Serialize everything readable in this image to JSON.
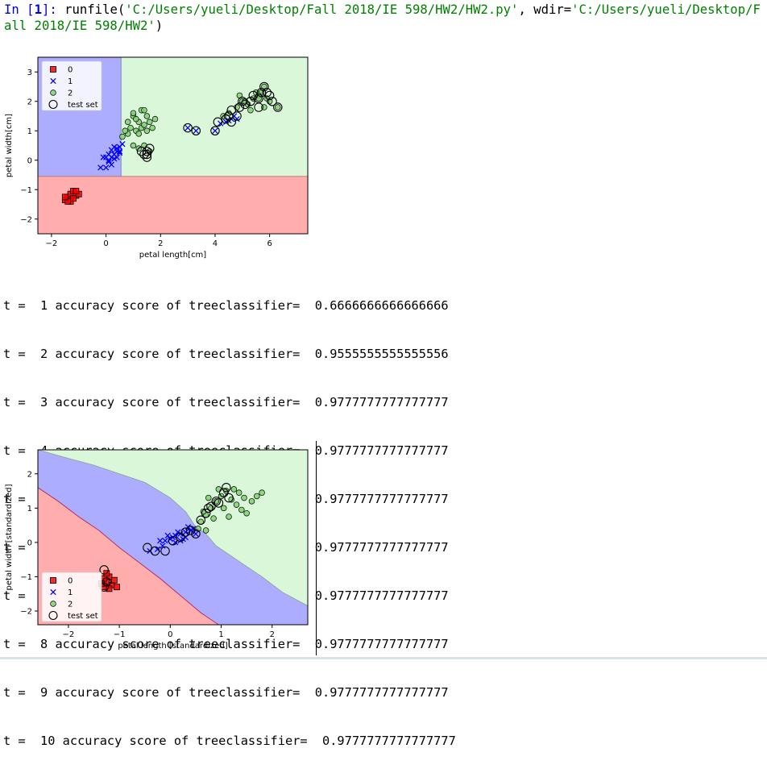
{
  "console": {
    "prompt_in": "In [",
    "prompt_num": "1",
    "prompt_close": "]: ",
    "call": "runfile(",
    "path": "'C:/Users/yueli/Desktop/Fall 2018/IE 598/HW2/HW2.py'",
    "sep": ", wdir=",
    "wdir": "'C:/Users/yueli/Desktop/Fall 2018/IE 598/HW2'",
    "close": ")"
  },
  "output_lines": [
    "t =  1 accuracy score of treeclassifier=  0.6666666666666666",
    "t =  2 accuracy score of treeclassifier=  0.9555555555555556",
    "t =  3 accuracy score of treeclassifier=  0.9777777777777777",
    "t =  4 accuracy score of treeclassifier=  0.9777777777777777",
    "t =  5 accuracy score of treeclassifier=  0.9777777777777777",
    "t =  6 accuracy score of treeclassifier=  0.9777777777777777",
    "t =  7 accuracy score of treeclassifier=  0.9777777777777777",
    "t =  8 accuracy score of treeclassifier=  0.9777777777777777",
    "t =  9 accuracy score of treeclassifier=  0.9777777777777777",
    "t =  10 accuracy score of treeclassifier=  0.9777777777777777"
  ],
  "colors": {
    "class0": "#ff0000",
    "class1": "#0000ff",
    "class2": "#7cd26f",
    "region0": "#ffadad",
    "region1": "#adadff",
    "region2": "#daf7da",
    "prompt": "#0000e0",
    "string": "#008000"
  },
  "chart_data": [
    {
      "type": "scatter",
      "title": "",
      "xlabel": "petal length[cm]",
      "ylabel": "petal width[cm]",
      "xlim": [
        -2.5,
        7.4
      ],
      "ylim": [
        -2.5,
        3.5
      ],
      "xticks": [
        -2,
        0,
        2,
        4,
        6
      ],
      "yticks": [
        -2,
        -1,
        0,
        1,
        2,
        3
      ],
      "xtick_labels": [
        "−2",
        "0",
        "2",
        "4",
        "6"
      ],
      "ytick_labels": [
        "−2",
        "−1",
        "0",
        "1",
        "2",
        "3"
      ],
      "legend_position": "top-left",
      "legend": [
        "0",
        "1",
        "2",
        "test set"
      ],
      "regions": [
        {
          "class": "0",
          "x": [
            -2.5,
            7.4
          ],
          "y": [
            -2.5,
            -0.55
          ]
        },
        {
          "class": "1",
          "x": [
            -2.5,
            0.55
          ],
          "y": [
            -0.55,
            3.5
          ]
        },
        {
          "class": "2",
          "x": [
            0.55,
            7.4
          ],
          "y": [
            -0.55,
            3.5
          ]
        }
      ],
      "series": [
        {
          "name": "0",
          "marker": "square",
          "points": [
            [
              -1.5,
              -1.35
            ],
            [
              -1.4,
              -1.25
            ],
            [
              -1.3,
              -1.3
            ],
            [
              -1.3,
              -1.15
            ],
            [
              -1.2,
              -1.05
            ],
            [
              -1.1,
              -1.2
            ],
            [
              -1.3,
              -1.4
            ],
            [
              -1.4,
              -1.4
            ],
            [
              -1.2,
              -1.3
            ],
            [
              -1.0,
              -1.15
            ],
            [
              -1.5,
              -1.25
            ],
            [
              -1.1,
              -1.05
            ]
          ]
        },
        {
          "name": "1",
          "marker": "x",
          "points": [
            [
              -0.2,
              -0.25
            ],
            [
              0.0,
              -0.25
            ],
            [
              0.1,
              0.0
            ],
            [
              0.2,
              0.1
            ],
            [
              0.3,
              0.2
            ],
            [
              0.4,
              0.3
            ],
            [
              0.5,
              0.45
            ],
            [
              0.2,
              0.35
            ],
            [
              0.1,
              0.2
            ],
            [
              0.3,
              0.05
            ],
            [
              0.5,
              0.25
            ],
            [
              0.0,
              0.1
            ],
            [
              -0.1,
              0.1
            ],
            [
              0.4,
              0.1
            ],
            [
              0.6,
              0.55
            ],
            [
              0.2,
              -0.15
            ],
            [
              0.3,
              0.45
            ],
            [
              0.1,
              -0.05
            ],
            [
              0.4,
              0.4
            ],
            [
              0.5,
              0.3
            ],
            [
              3.0,
              1.1
            ],
            [
              3.3,
              1.0
            ],
            [
              4.0,
              1.0
            ],
            [
              4.2,
              1.25
            ],
            [
              4.4,
              1.3
            ],
            [
              4.6,
              1.4
            ],
            [
              4.7,
              1.5
            ],
            [
              4.8,
              1.4
            ],
            [
              4.5,
              1.35
            ]
          ]
        },
        {
          "name": "2",
          "marker": "circle",
          "points": [
            [
              0.6,
              0.8
            ],
            [
              0.8,
              0.9
            ],
            [
              0.9,
              1.1
            ],
            [
              0.8,
              1.3
            ],
            [
              1.0,
              1.5
            ],
            [
              1.2,
              1.3
            ],
            [
              1.3,
              1.1
            ],
            [
              1.1,
              1.0
            ],
            [
              1.4,
              1.2
            ],
            [
              1.5,
              1.5
            ],
            [
              1.3,
              1.7
            ],
            [
              1.6,
              1.3
            ],
            [
              1.7,
              1.1
            ],
            [
              1.8,
              1.4
            ],
            [
              1.0,
              1.6
            ],
            [
              1.2,
              0.9
            ],
            [
              1.4,
              1.7
            ],
            [
              0.7,
              1.0
            ],
            [
              1.1,
              1.4
            ],
            [
              1.5,
              1.0
            ],
            [
              1.2,
              0.4
            ],
            [
              1.4,
              0.5
            ],
            [
              1.6,
              0.3
            ],
            [
              1.0,
              0.5
            ],
            [
              4.3,
              1.5
            ],
            [
              4.5,
              1.6
            ],
            [
              4.8,
              1.8
            ],
            [
              5.0,
              2.0
            ],
            [
              5.2,
              1.9
            ],
            [
              5.4,
              2.1
            ],
            [
              5.5,
              2.3
            ],
            [
              5.7,
              2.3
            ],
            [
              5.9,
              2.1
            ],
            [
              6.0,
              2.0
            ],
            [
              5.8,
              1.8
            ],
            [
              5.6,
              2.2
            ],
            [
              5.1,
              2.0
            ],
            [
              6.3,
              1.8
            ],
            [
              5.3,
              1.7
            ],
            [
              4.9,
              2.2
            ],
            [
              5.8,
              2.5
            ],
            [
              5.6,
              2.1
            ]
          ]
        },
        {
          "name": "test set",
          "marker": "ring",
          "points": [
            [
              1.3,
              0.3
            ],
            [
              1.4,
              0.2
            ],
            [
              1.5,
              0.3
            ],
            [
              1.5,
              0.1
            ],
            [
              1.6,
              0.4
            ],
            [
              1.5,
              0.2
            ],
            [
              3.0,
              1.1
            ],
            [
              3.3,
              1.0
            ],
            [
              4.0,
              1.0
            ],
            [
              4.1,
              1.3
            ],
            [
              4.4,
              1.4
            ],
            [
              4.6,
              1.3
            ],
            [
              4.5,
              1.5
            ],
            [
              4.8,
              1.5
            ],
            [
              4.6,
              1.7
            ],
            [
              4.9,
              1.8
            ],
            [
              5.0,
              2.0
            ],
            [
              5.1,
              1.9
            ],
            [
              5.3,
              2.0
            ],
            [
              5.4,
              2.2
            ],
            [
              5.6,
              2.1
            ],
            [
              5.7,
              2.3
            ],
            [
              5.8,
              2.5
            ],
            [
              5.9,
              2.3
            ],
            [
              6.0,
              2.2
            ],
            [
              6.1,
              2.0
            ],
            [
              5.6,
              1.8
            ],
            [
              6.3,
              1.8
            ]
          ]
        }
      ]
    },
    {
      "type": "scatter",
      "title": "",
      "xlabel": "petal length [standardized]",
      "ylabel": "petal width [standardized]",
      "xlim": [
        -2.6,
        2.7
      ],
      "ylim": [
        -2.4,
        2.7
      ],
      "xticks": [
        -2,
        -1,
        0,
        1,
        2
      ],
      "yticks": [
        -2,
        -1,
        0,
        1,
        2
      ],
      "xtick_labels": [
        "−2",
        "−1",
        "0",
        "1",
        "2"
      ],
      "ytick_labels": [
        "−2",
        "−1",
        "0",
        "1",
        "2"
      ],
      "legend_position": "lower-left",
      "legend": [
        "0",
        "1",
        "2",
        "test set"
      ],
      "boundaries": {
        "upper": [
          [
            -2.6,
            2.7
          ],
          [
            -2.0,
            2.45
          ],
          [
            -1.5,
            2.25
          ],
          [
            -1.0,
            2.0
          ],
          [
            -0.5,
            1.75
          ],
          [
            0.0,
            1.3
          ],
          [
            0.3,
            0.9
          ],
          [
            0.5,
            0.45
          ],
          [
            0.7,
            0.25
          ],
          [
            0.9,
            -0.1
          ],
          [
            1.3,
            -0.5
          ],
          [
            1.8,
            -1.0
          ],
          [
            2.2,
            -1.45
          ],
          [
            2.7,
            -1.85
          ]
        ],
        "lower": [
          [
            -2.6,
            1.6
          ],
          [
            -2.2,
            1.2
          ],
          [
            -1.8,
            0.75
          ],
          [
            -1.4,
            0.35
          ],
          [
            -1.0,
            -0.15
          ],
          [
            -0.6,
            -0.6
          ],
          [
            -0.2,
            -1.05
          ],
          [
            0.2,
            -1.55
          ],
          [
            0.6,
            -2.05
          ],
          [
            0.95,
            -2.4
          ]
        ]
      },
      "series": [
        {
          "name": "0",
          "marker": "square",
          "points": [
            [
              -1.3,
              -1.3
            ],
            [
              -1.25,
              -1.15
            ],
            [
              -1.2,
              -1.0
            ],
            [
              -1.15,
              -1.25
            ],
            [
              -1.1,
              -1.1
            ],
            [
              -1.3,
              -1.05
            ],
            [
              -1.05,
              -1.3
            ],
            [
              -1.2,
              -1.35
            ],
            [
              -1.35,
              -1.2
            ],
            [
              -1.25,
              -0.9
            ]
          ]
        },
        {
          "name": "1",
          "marker": "x",
          "points": [
            [
              -0.4,
              -0.25
            ],
            [
              -0.25,
              -0.2
            ],
            [
              -0.15,
              -0.1
            ],
            [
              -0.1,
              0.05
            ],
            [
              0.0,
              0.1
            ],
            [
              0.1,
              0.2
            ],
            [
              0.2,
              0.25
            ],
            [
              0.3,
              0.3
            ],
            [
              0.4,
              0.35
            ],
            [
              0.45,
              0.4
            ],
            [
              0.3,
              0.15
            ],
            [
              0.2,
              0.05
            ],
            [
              0.1,
              0.0
            ],
            [
              0.5,
              0.25
            ],
            [
              0.35,
              0.45
            ],
            [
              0.15,
              0.3
            ],
            [
              -0.05,
              0.2
            ],
            [
              0.25,
              0.1
            ],
            [
              0.05,
              0.15
            ],
            [
              -0.2,
              0.05
            ]
          ]
        },
        {
          "name": "2",
          "marker": "circle",
          "points": [
            [
              0.6,
              0.6
            ],
            [
              0.7,
              0.8
            ],
            [
              0.8,
              1.0
            ],
            [
              0.9,
              1.2
            ],
            [
              1.0,
              1.35
            ],
            [
              1.1,
              1.5
            ],
            [
              1.2,
              1.25
            ],
            [
              1.3,
              1.1
            ],
            [
              1.4,
              0.95
            ],
            [
              1.5,
              0.85
            ],
            [
              1.6,
              1.2
            ],
            [
              1.7,
              1.35
            ],
            [
              1.8,
              1.45
            ],
            [
              0.75,
              1.3
            ],
            [
              0.95,
              1.55
            ],
            [
              1.05,
              1.0
            ],
            [
              0.65,
              0.9
            ],
            [
              1.25,
              1.55
            ],
            [
              1.15,
              0.75
            ],
            [
              1.35,
              1.45
            ],
            [
              0.85,
              0.7
            ],
            [
              1.45,
              1.3
            ],
            [
              0.55,
              0.4
            ],
            [
              0.7,
              0.35
            ]
          ]
        },
        {
          "name": "test set",
          "marker": "ring",
          "points": [
            [
              -0.45,
              -0.15
            ],
            [
              -0.3,
              -0.25
            ],
            [
              -0.1,
              -0.25
            ],
            [
              0.05,
              0.05
            ],
            [
              0.2,
              0.15
            ],
            [
              0.3,
              0.3
            ],
            [
              0.4,
              0.35
            ],
            [
              0.5,
              0.25
            ],
            [
              0.6,
              0.65
            ],
            [
              0.7,
              0.85
            ],
            [
              0.8,
              1.05
            ],
            [
              0.9,
              1.2
            ],
            [
              1.05,
              1.45
            ],
            [
              1.1,
              1.6
            ],
            [
              1.15,
              1.3
            ],
            [
              0.75,
              1.0
            ],
            [
              0.95,
              1.15
            ],
            [
              -1.3,
              -1.3
            ],
            [
              -1.25,
              -1.15
            ],
            [
              -1.3,
              -0.8
            ]
          ]
        }
      ]
    }
  ]
}
